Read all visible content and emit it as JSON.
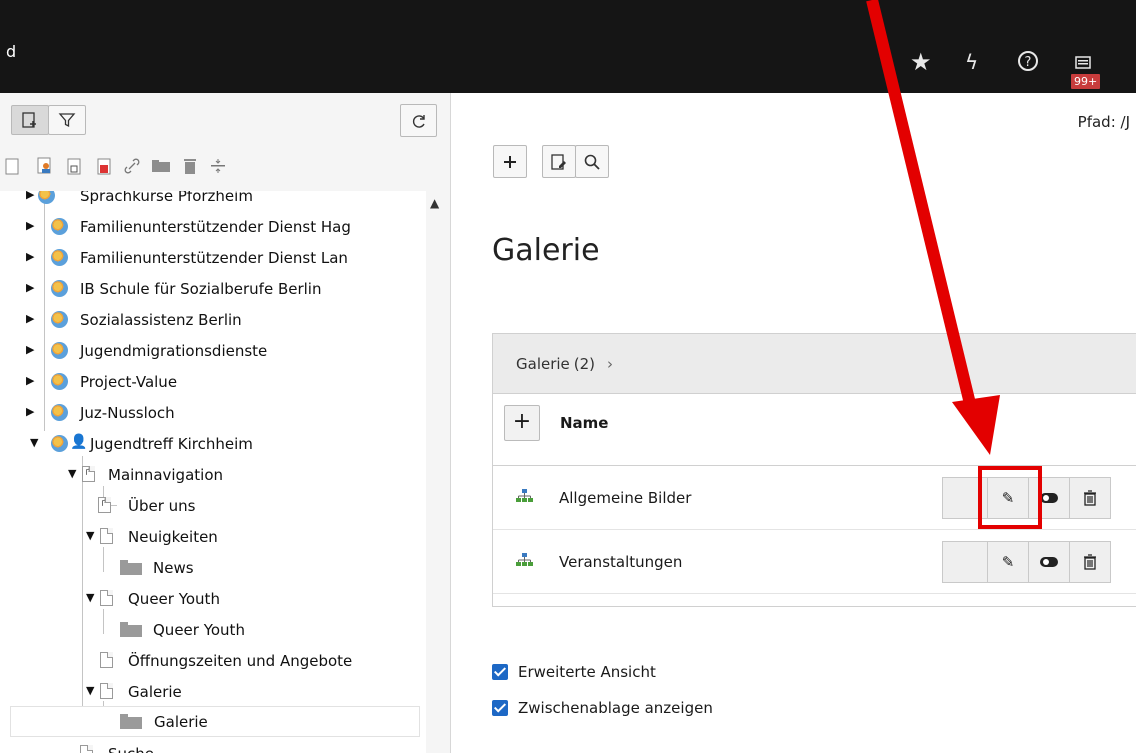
{
  "topbar": {
    "brand": "d",
    "badge": "99+",
    "icons": [
      "star-icon",
      "lightning-icon",
      "help-icon",
      "notifications-icon"
    ]
  },
  "tree_toolbar": {
    "buttons": [
      "new-page-icon",
      "filter-icon",
      "refresh-icon"
    ],
    "drag_icons": [
      "page-icon",
      "backend-user-page-icon",
      "shortcut-page-icon",
      "mountpoint-page-icon",
      "link-icon",
      "folder-icon",
      "recycler-icon",
      "spacer-icon"
    ]
  },
  "tree": {
    "items": [
      {
        "label": "Sprachkurse Pforzheim",
        "expanded": false
      },
      {
        "label": "Familienunterstützender Dienst Hag",
        "expanded": false
      },
      {
        "label": "Familienunterstützender Dienst Lan",
        "expanded": false
      },
      {
        "label": "IB Schule für Sozialberufe Berlin",
        "expanded": false
      },
      {
        "label": "Sozialassistenz Berlin",
        "expanded": false
      },
      {
        "label": "Jugendmigrationsdienste",
        "expanded": false
      },
      {
        "label": "Project-Value",
        "expanded": false
      },
      {
        "label": "Juz-Nussloch",
        "expanded": false
      },
      {
        "label": "Jugendtreff Kirchheim",
        "expanded": true
      },
      {
        "label": "Mainnavigation",
        "expanded": true
      },
      {
        "label": "Über uns"
      },
      {
        "label": "Neuigkeiten",
        "expanded": true
      },
      {
        "label": "News"
      },
      {
        "label": "Queer Youth",
        "expanded": true
      },
      {
        "label": "Queer Youth"
      },
      {
        "label": "Öffnungszeiten und Angebote"
      },
      {
        "label": "Galerie",
        "expanded": true
      },
      {
        "label": "Galerie",
        "selected": true
      },
      {
        "label": "Suche"
      }
    ]
  },
  "content": {
    "path": "Pfad: /J",
    "toolbar": [
      "add-icon",
      "edit-page-icon",
      "search-icon"
    ],
    "title": "Galerie",
    "table": {
      "heading": "Galerie",
      "count": "(2)",
      "chevron": "›",
      "add_label": "+",
      "column": "Name",
      "rows": [
        {
          "name": "Allgemeine Bilder"
        },
        {
          "name": "Veranstaltungen"
        }
      ]
    },
    "options": [
      {
        "label": "Erweiterte Ansicht",
        "checked": true
      },
      {
        "label": "Zwischenablage anzeigen",
        "checked": true
      }
    ]
  },
  "colors": {
    "annotation": "#e30000",
    "topbar": "#151515",
    "checkbox": "#1d68c5"
  }
}
